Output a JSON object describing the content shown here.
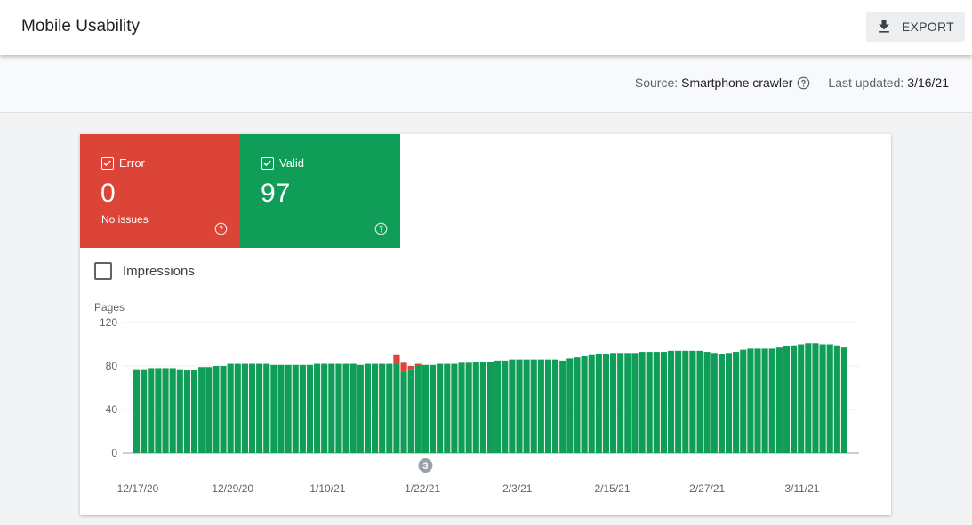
{
  "header": {
    "title": "Mobile Usability",
    "export_label": "EXPORT"
  },
  "meta": {
    "source_label": "Source:",
    "source_value": "Smartphone crawler",
    "updated_label": "Last updated:",
    "updated_value": "3/16/21"
  },
  "tiles": {
    "error": {
      "label": "Error",
      "count": "0",
      "sub": "No issues",
      "color": "#db4437"
    },
    "valid": {
      "label": "Valid",
      "count": "97",
      "color": "#0f9d58"
    }
  },
  "impressions_label": "Impressions",
  "chart_data": {
    "type": "bar",
    "ylabel": "Pages",
    "ylim": [
      0,
      120
    ],
    "yticks": [
      "0",
      "40",
      "80",
      "120"
    ],
    "x_tick_labels": [
      "12/17/20",
      "12/29/20",
      "1/10/21",
      "1/22/21",
      "2/3/21",
      "2/15/21",
      "2/27/21",
      "3/11/21"
    ],
    "annotation": "3",
    "stacked": true,
    "series": [
      {
        "color": "#0f9d58",
        "values": [
          77,
          77,
          78,
          78,
          78,
          78,
          77,
          76,
          76,
          79,
          79,
          80,
          80,
          82,
          82,
          82,
          82,
          82,
          82,
          81,
          81,
          81,
          81,
          81,
          81,
          82,
          82,
          82,
          82,
          82,
          82,
          81,
          82,
          82,
          82,
          82,
          82,
          75,
          77,
          80,
          81,
          81,
          82,
          82,
          82,
          83,
          83,
          84,
          84,
          84,
          85,
          85,
          86,
          86,
          86,
          86,
          86,
          86,
          86,
          85,
          87,
          88,
          89,
          90,
          91,
          91,
          92,
          92,
          92,
          92,
          93,
          93,
          93,
          93,
          94,
          94,
          94,
          94,
          94,
          93,
          92,
          91,
          92,
          93,
          95,
          96,
          96,
          96,
          96,
          97,
          98,
          99,
          100,
          101,
          101,
          100,
          100,
          99,
          97
        ]
      },
      {
        "color": "#db4437",
        "values": [
          0,
          0,
          0,
          0,
          0,
          0,
          0,
          0,
          0,
          0,
          0,
          0,
          0,
          0,
          0,
          0,
          0,
          0,
          0,
          0,
          0,
          0,
          0,
          0,
          0,
          0,
          0,
          0,
          0,
          0,
          0,
          0,
          0,
          0,
          0,
          0,
          8,
          8,
          3,
          2,
          0,
          0,
          0,
          0,
          0,
          0,
          0,
          0,
          0,
          0,
          0,
          0,
          0,
          0,
          0,
          0,
          0,
          0,
          0,
          0,
          0,
          0,
          0,
          0,
          0,
          0,
          0,
          0,
          0,
          0,
          0,
          0,
          0,
          0,
          0,
          0,
          0,
          0,
          0,
          0,
          0,
          0,
          0,
          0,
          0,
          0,
          0,
          0,
          0,
          0,
          0,
          0,
          0,
          0,
          0,
          0,
          0,
          0,
          0
        ]
      }
    ]
  }
}
